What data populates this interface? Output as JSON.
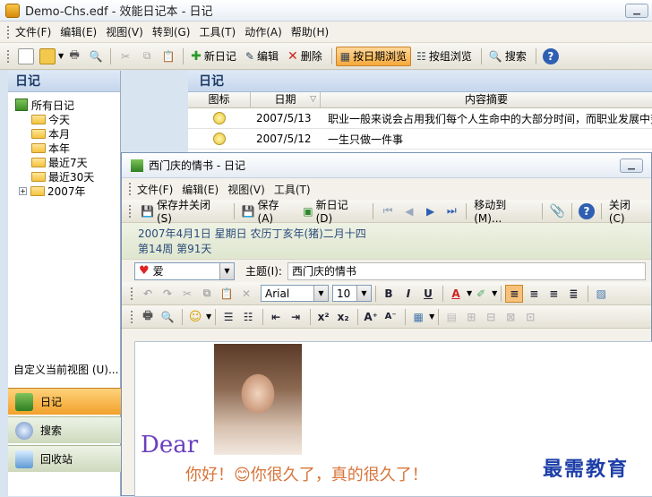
{
  "main": {
    "title": "Demo-Chs.edf - 效能日记本 - 日记",
    "menu": [
      "文件(F)",
      "编辑(E)",
      "视图(V)",
      "转到(G)",
      "工具(T)",
      "动作(A)",
      "帮助(H)"
    ],
    "toolbar": {
      "new_diary": "新日记",
      "edit": "编辑",
      "delete": "删除",
      "by_date": "按日期浏览",
      "by_group": "按组浏览",
      "search": "搜索"
    }
  },
  "left_panel": {
    "header": "日记",
    "root": "所有日记",
    "items": [
      "今天",
      "本月",
      "本年",
      "最近7天",
      "最近30天",
      "2007年"
    ],
    "custom_view": "自定义当前视图 (U)...",
    "nav": [
      "日记",
      "搜索",
      "回收站"
    ]
  },
  "list": {
    "header": "日记",
    "columns": [
      "图标",
      "日期",
      "内容摘要"
    ],
    "rows": [
      {
        "date": "2007/5/13",
        "summary": "职业一般来说会占用我们每个人生命中的大部分时间，而职业发展中变"
      },
      {
        "date": "2007/5/12",
        "summary": "一生只做一件事"
      }
    ]
  },
  "child": {
    "title": "西门庆的情书 - 日记",
    "menu": [
      "文件(F)",
      "编辑(E)",
      "视图(V)",
      "工具(T)"
    ],
    "toolbar": {
      "save_close": "保存并关闭(S)",
      "save": "保存(A)",
      "new_diary": "新日记(D)",
      "move_to": "移动到(M)...",
      "close": "关闭(C)"
    },
    "date_line": "2007年4月1日  星期日  农历丁亥年(猪)二月十四",
    "week_line": "第14周  第91天",
    "mood": "爱",
    "subject_label": "主题(I):",
    "subject": "西门庆的情书",
    "font": "Arial",
    "font_size": "10",
    "body": {
      "dear": "Dear",
      "greeting": "你好！😊你很久了，真的很久了！"
    }
  },
  "watermark": "最需教育"
}
